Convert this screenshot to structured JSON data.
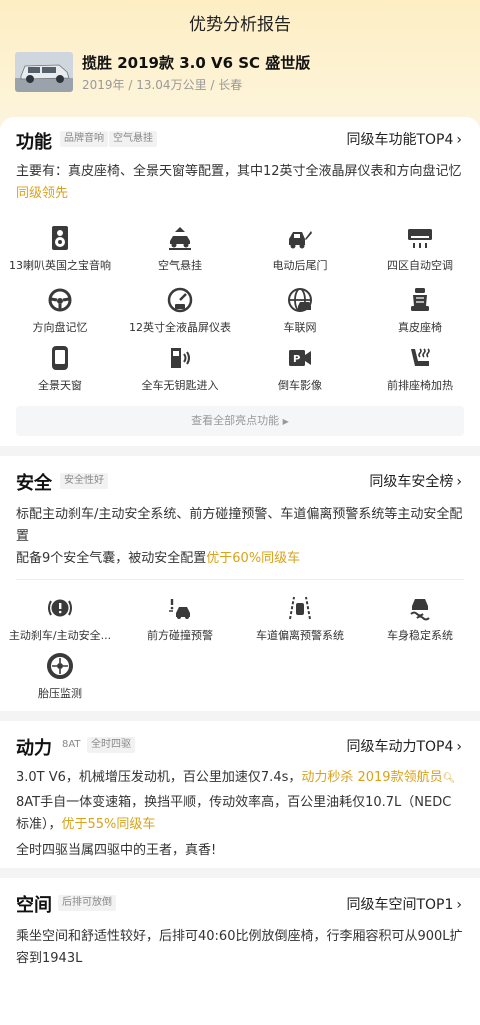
{
  "header": {
    "title": "优势分析报告",
    "car_name": "揽胜 2019款 3.0 V6 SC 盛世版",
    "car_meta": "2019年 / 13.04万公里 / 长春"
  },
  "function": {
    "title": "功能",
    "tags": [
      "品牌音响",
      "空气悬挂"
    ],
    "rank_link": "同级车功能TOP4",
    "desc_main": "主要有：真皮座椅、全景天窗等配置，其中12英寸全液晶屏仪表和方向盘记忆",
    "desc_highlight": "同级领先",
    "features": [
      {
        "label": "13喇叭英国之宝音响",
        "icon": "speaker-icon"
      },
      {
        "label": "空气悬挂",
        "icon": "air-suspension-icon"
      },
      {
        "label": "电动后尾门",
        "icon": "power-tailgate-icon"
      },
      {
        "label": "四区自动空调",
        "icon": "air-conditioner-icon"
      },
      {
        "label": "方向盘记忆",
        "icon": "steering-wheel-icon"
      },
      {
        "label": "12英寸全液晶屏仪表",
        "icon": "lcd-gauge-icon"
      },
      {
        "label": "车联网",
        "icon": "connected-car-icon"
      },
      {
        "label": "真皮座椅",
        "icon": "leather-seat-icon"
      },
      {
        "label": "全景天窗",
        "icon": "panoramic-sunroof-icon"
      },
      {
        "label": "全车无钥匙进入",
        "icon": "keyless-entry-icon"
      },
      {
        "label": "倒车影像",
        "icon": "reverse-camera-icon"
      },
      {
        "label": "前排座椅加热",
        "icon": "seat-heating-icon"
      }
    ],
    "more_label": "查看全部亮点功能"
  },
  "safety": {
    "title": "安全",
    "tag": "安全性好",
    "rank_link": "同级车安全榜",
    "desc1": "标配主动刹车/主动安全系统、前方碰撞预警、车道偏离预警系统等主动安全配置",
    "desc2_main": "配备9个安全气囊，被动安全配置",
    "desc2_highlight": "优于60%同级车",
    "features": [
      {
        "label": "主动刹车/主动安全...",
        "icon": "active-brake-icon"
      },
      {
        "label": "前方碰撞预警",
        "icon": "collision-warning-icon"
      },
      {
        "label": "车道偏离预警系统",
        "icon": "lane-departure-icon"
      },
      {
        "label": "车身稳定系统",
        "icon": "stability-control-icon"
      },
      {
        "label": "胎压监测",
        "icon": "tire-pressure-icon"
      }
    ]
  },
  "power": {
    "title": "动力",
    "tags": [
      "8AT",
      "全时四驱"
    ],
    "rank_link": "同级车动力TOP4",
    "desc1_main": "3.0T V6，机械增压发动机，百公里加速仅7.4s，",
    "desc1_highlight": "动力秒杀 2019款领航员",
    "desc2_main": "8AT手自一体变速箱，换挡平顺，传动效率高，百公里油耗仅10.7L（NEDC标准），",
    "desc2_highlight": "优于55%同级车",
    "desc3": "全时四驱当属四驱中的王者，真香!"
  },
  "space": {
    "title": "空间",
    "tag": "后排可放倒",
    "rank_link": "同级车空间TOP1",
    "desc": "乘坐空间和舒适性较好，后排可40:60比例放倒座椅，行李厢容积可从900L扩容到1943L"
  },
  "colors": {
    "accent_gold": "#d9a21b",
    "icon_dark": "#3a3a3a",
    "hero_bg": "#fdeec4"
  }
}
